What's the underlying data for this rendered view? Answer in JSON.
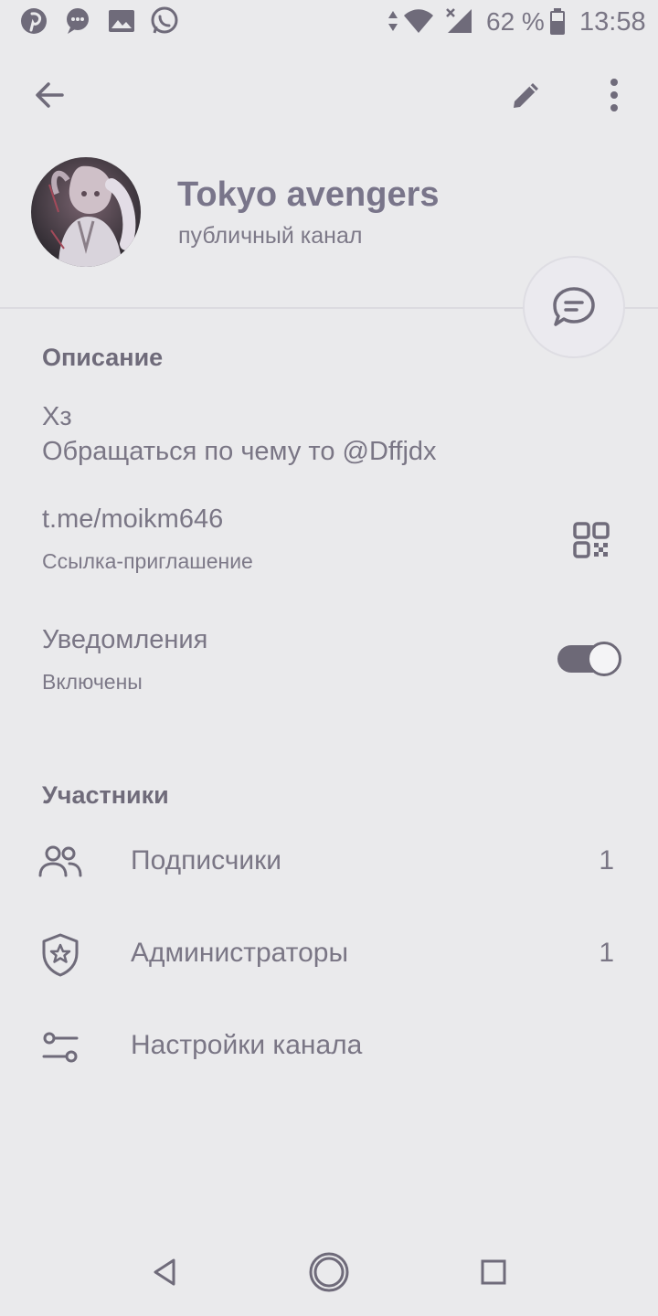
{
  "status_bar": {
    "battery": "62 %",
    "time": "13:58",
    "icons": [
      "pinterest-icon",
      "messenger-icon",
      "gallery-icon",
      "whatsapp-icon",
      "data-arrows-icon",
      "wifi-icon",
      "signal-icon",
      "battery-icon"
    ]
  },
  "toolbar": {
    "back_icon": "arrow-left-icon",
    "edit_icon": "pencil-icon",
    "more_icon": "more-vertical-icon"
  },
  "profile": {
    "title": "Tokyo avengers",
    "subtitle": "публичный канал",
    "fab_icon": "chat-bubble-icon"
  },
  "info": {
    "description_header": "Описание",
    "description_line1": "Хз",
    "description_line2": "Обращаться по чему то @Dffjdx",
    "link": "t.me/moikm646",
    "link_caption": "Ссылка-приглашение",
    "qr_icon": "qr-code-icon",
    "notifications_label": "Уведомления",
    "notifications_status": "Включены",
    "notifications_on": true
  },
  "members": {
    "header": "Участники",
    "rows": [
      {
        "label": "Подписчики",
        "count": "1",
        "icon": "users-icon"
      },
      {
        "label": "Администраторы",
        "count": "1",
        "icon": "shield-star-icon"
      },
      {
        "label": "Настройки канала",
        "count": "",
        "icon": "sliders-icon"
      }
    ]
  },
  "nav_bar": {
    "icons": [
      "nav-back-icon",
      "nav-home-icon",
      "nav-recents-icon"
    ]
  },
  "colors": {
    "background": "#eaeaec",
    "text": "#6f6b7a",
    "icon": "#6f6b7a"
  }
}
